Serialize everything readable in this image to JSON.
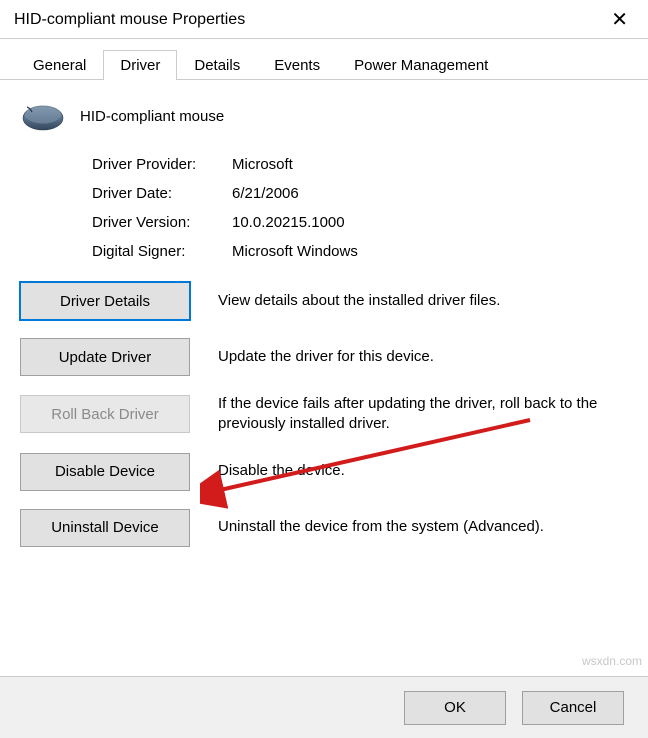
{
  "window": {
    "title": "HID-compliant mouse Properties"
  },
  "tabs": {
    "general": "General",
    "driver": "Driver",
    "details": "Details",
    "events": "Events",
    "power": "Power Management",
    "active": "driver"
  },
  "device": {
    "name": "HID-compliant mouse"
  },
  "info": {
    "provider_label": "Driver Provider:",
    "provider_value": "Microsoft",
    "date_label": "Driver Date:",
    "date_value": "6/21/2006",
    "version_label": "Driver Version:",
    "version_value": "10.0.20215.1000",
    "signer_label": "Digital Signer:",
    "signer_value": "Microsoft Windows"
  },
  "actions": {
    "details_label": "Driver Details",
    "details_desc": "View details about the installed driver files.",
    "update_label": "Update Driver",
    "update_desc": "Update the driver for this device.",
    "rollback_label": "Roll Back Driver",
    "rollback_desc": "If the device fails after updating the driver, roll back to the previously installed driver.",
    "disable_label": "Disable Device",
    "disable_desc": "Disable the device.",
    "uninstall_label": "Uninstall Device",
    "uninstall_desc": "Uninstall the device from the system (Advanced)."
  },
  "buttons": {
    "ok": "OK",
    "cancel": "Cancel"
  },
  "watermark": "wsxdn.com"
}
